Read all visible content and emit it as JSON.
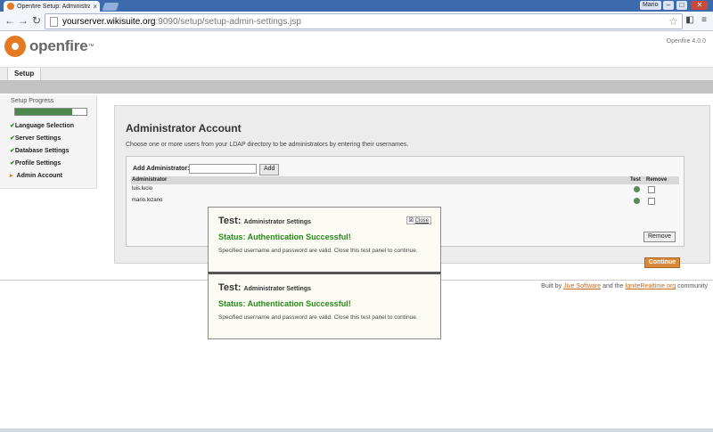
{
  "browser": {
    "tab_title": "Openfire Setup: Administrato",
    "tab_close": "×",
    "window_user": "Mario",
    "window_buttons": {
      "minimize": "–",
      "maximize": "□",
      "close": "✕"
    },
    "url_host": "yourserver.wikisuite.org",
    "url_rest": ":9090/setup/setup-admin-settings.jsp"
  },
  "header": {
    "logo_text": "openfire",
    "logo_tm": "™",
    "version": "Openfire 4.0.0",
    "tab_label": "Setup"
  },
  "sidebar": {
    "title": "Setup Progress",
    "progress_percent": 80,
    "steps": [
      {
        "mark": "✔",
        "label": "Language Selection"
      },
      {
        "mark": "✔",
        "label": "Server Settings"
      },
      {
        "mark": "✔",
        "label": "Database Settings"
      },
      {
        "mark": "✔",
        "label": "Profile Settings"
      },
      {
        "mark": "▸",
        "label": "Admin Account"
      }
    ]
  },
  "main": {
    "title": "Administrator Account",
    "description": "Choose one or more users from your LDAP directory to be administrators by entering their usernames.",
    "add_label": "Add Administrator:",
    "add_input_value": "",
    "add_button": "Add",
    "columns": {
      "admin": "Administrator",
      "test": "Test",
      "remove": "Remove"
    },
    "admins": [
      "luis.lucio",
      "mario.lozano"
    ],
    "remove_button": "Remove",
    "continue_button": "Continue"
  },
  "footer": {
    "prefix": "Built by",
    "link1": "Jive Software",
    "middle": "and the",
    "link2": "IgniteRealtime.org",
    "suffix": "community"
  },
  "test_panels": [
    {
      "title": "Test:",
      "subtitle": "Administrator Settings",
      "close_label": "Close",
      "status": "Status: Authentication Successful!",
      "message": "Specified username and password are valid. Close this test panel to continue."
    },
    {
      "title": "Test:",
      "subtitle": "Administrator Settings",
      "status": "Status: Authentication Successful!",
      "message": "Specified username and password are valid. Close this test panel to continue."
    }
  ],
  "colors": {
    "brand": "#e57a24",
    "success": "#2a8a1b",
    "chrome": "#3d69ad"
  }
}
